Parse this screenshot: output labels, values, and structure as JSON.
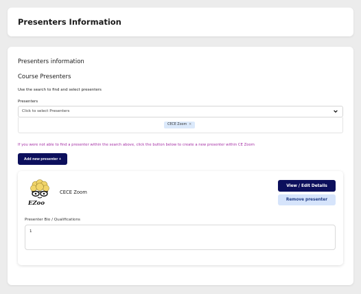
{
  "header": {
    "title": "Presenters Information"
  },
  "main": {
    "section_title": "Presenters information",
    "sub_title": "Course Presenters",
    "hint": "Use the search to find and select presenters",
    "field_label": "Presenters",
    "select_placeholder": "Click to select Presenters",
    "selected_chips": [
      {
        "label": "CECE Zoom",
        "remove": "×"
      }
    ],
    "notice": "If you were not able to find a presenter within the search above, click the button below to create a new presenter within CE Zoom",
    "add_button": "Add new presenter +"
  },
  "presenter_card": {
    "name": "CECE Zoom",
    "logo_text": "EZoo",
    "view_button": "View / Edit Details",
    "remove_button": "Remove presenter",
    "bio_label": "Presenter Bio / Qualifications",
    "bio_value": "1"
  },
  "colors": {
    "primary": "#0c0f5c",
    "notice": "#a32ca3",
    "chip_bg": "#dbe9fb",
    "secondary_btn_bg": "#d6e4fb"
  },
  "icons": {
    "select": "chevron-down-icon",
    "chip_remove": "close-icon",
    "logo": "brain-glasses-logo"
  }
}
